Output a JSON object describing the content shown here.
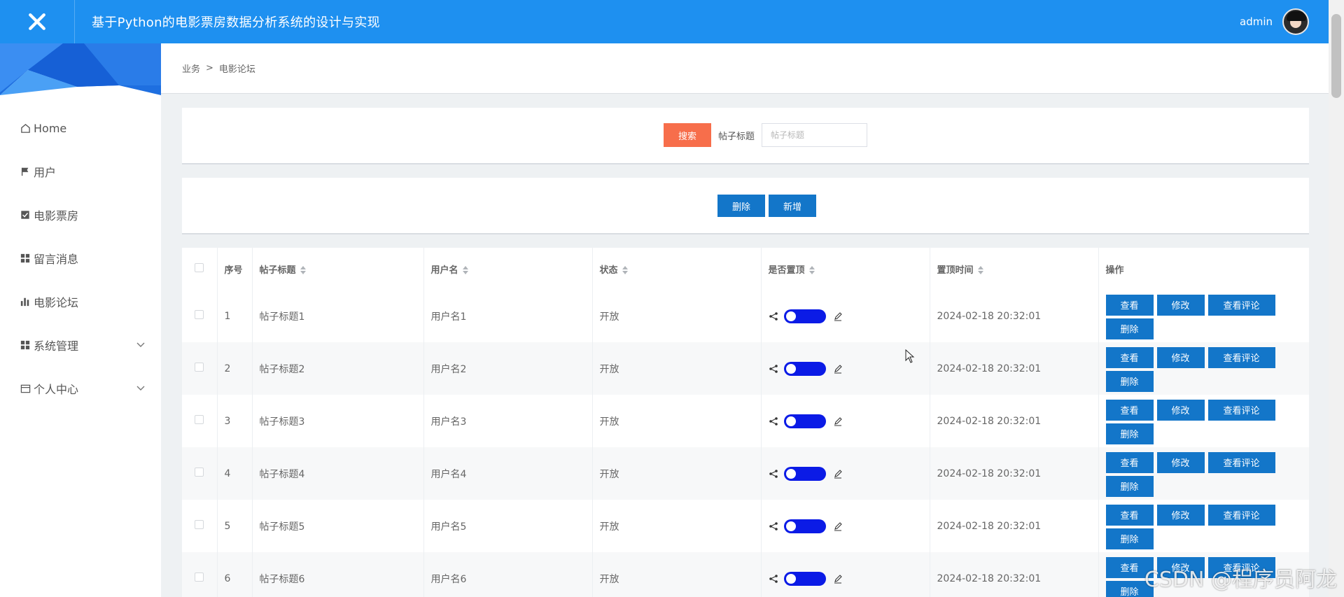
{
  "header": {
    "title": "基于Python的电影票房数据分析系统的设计与实现",
    "username": "admin",
    "bg_color": "#1e90f0"
  },
  "sidebar": {
    "items": [
      {
        "label": "Home",
        "icon": "home-icon"
      },
      {
        "label": "用户",
        "icon": "flag-icon"
      },
      {
        "label": "电影票房",
        "icon": "checkbox-icon"
      },
      {
        "label": "留言消息",
        "icon": "grid-icon"
      },
      {
        "label": "电影论坛",
        "icon": "bar-chart-icon"
      },
      {
        "label": "系统管理",
        "icon": "grid-icon",
        "expandable": true
      },
      {
        "label": "个人中心",
        "icon": "card-icon",
        "expandable": true
      }
    ]
  },
  "breadcrumb": {
    "parent": "业务",
    "separator": ">",
    "current": "电影论坛"
  },
  "search": {
    "button_label": "搜索",
    "field_label": "帖子标题",
    "placeholder": "帖子标题"
  },
  "actions": {
    "delete_label": "删除",
    "add_label": "新增"
  },
  "table": {
    "columns": [
      "序号",
      "帖子标题",
      "用户名",
      "状态",
      "是否置顶",
      "置顶时间",
      "操作"
    ],
    "rows": [
      {
        "index": "1",
        "title": "帖子标题1",
        "username": "用户名1",
        "status": "开放",
        "pinned": true,
        "time": "2024-02-18 20:32:01"
      },
      {
        "index": "2",
        "title": "帖子标题2",
        "username": "用户名2",
        "status": "开放",
        "pinned": true,
        "time": "2024-02-18 20:32:01"
      },
      {
        "index": "3",
        "title": "帖子标题3",
        "username": "用户名3",
        "status": "开放",
        "pinned": true,
        "time": "2024-02-18 20:32:01"
      },
      {
        "index": "4",
        "title": "帖子标题4",
        "username": "用户名4",
        "status": "开放",
        "pinned": true,
        "time": "2024-02-18 20:32:01"
      },
      {
        "index": "5",
        "title": "帖子标题5",
        "username": "用户名5",
        "status": "开放",
        "pinned": true,
        "time": "2024-02-18 20:32:01"
      },
      {
        "index": "6",
        "title": "帖子标题6",
        "username": "用户名6",
        "status": "开放",
        "pinned": true,
        "time": "2024-02-18 20:32:01"
      }
    ],
    "row_actions": {
      "view": "查看",
      "edit": "修改",
      "view_comments": "查看评论",
      "delete": "删除"
    },
    "action_color": "#1376c9",
    "toggle_color": "#0b1be6"
  },
  "watermark": "CSDN @程序员阿龙"
}
